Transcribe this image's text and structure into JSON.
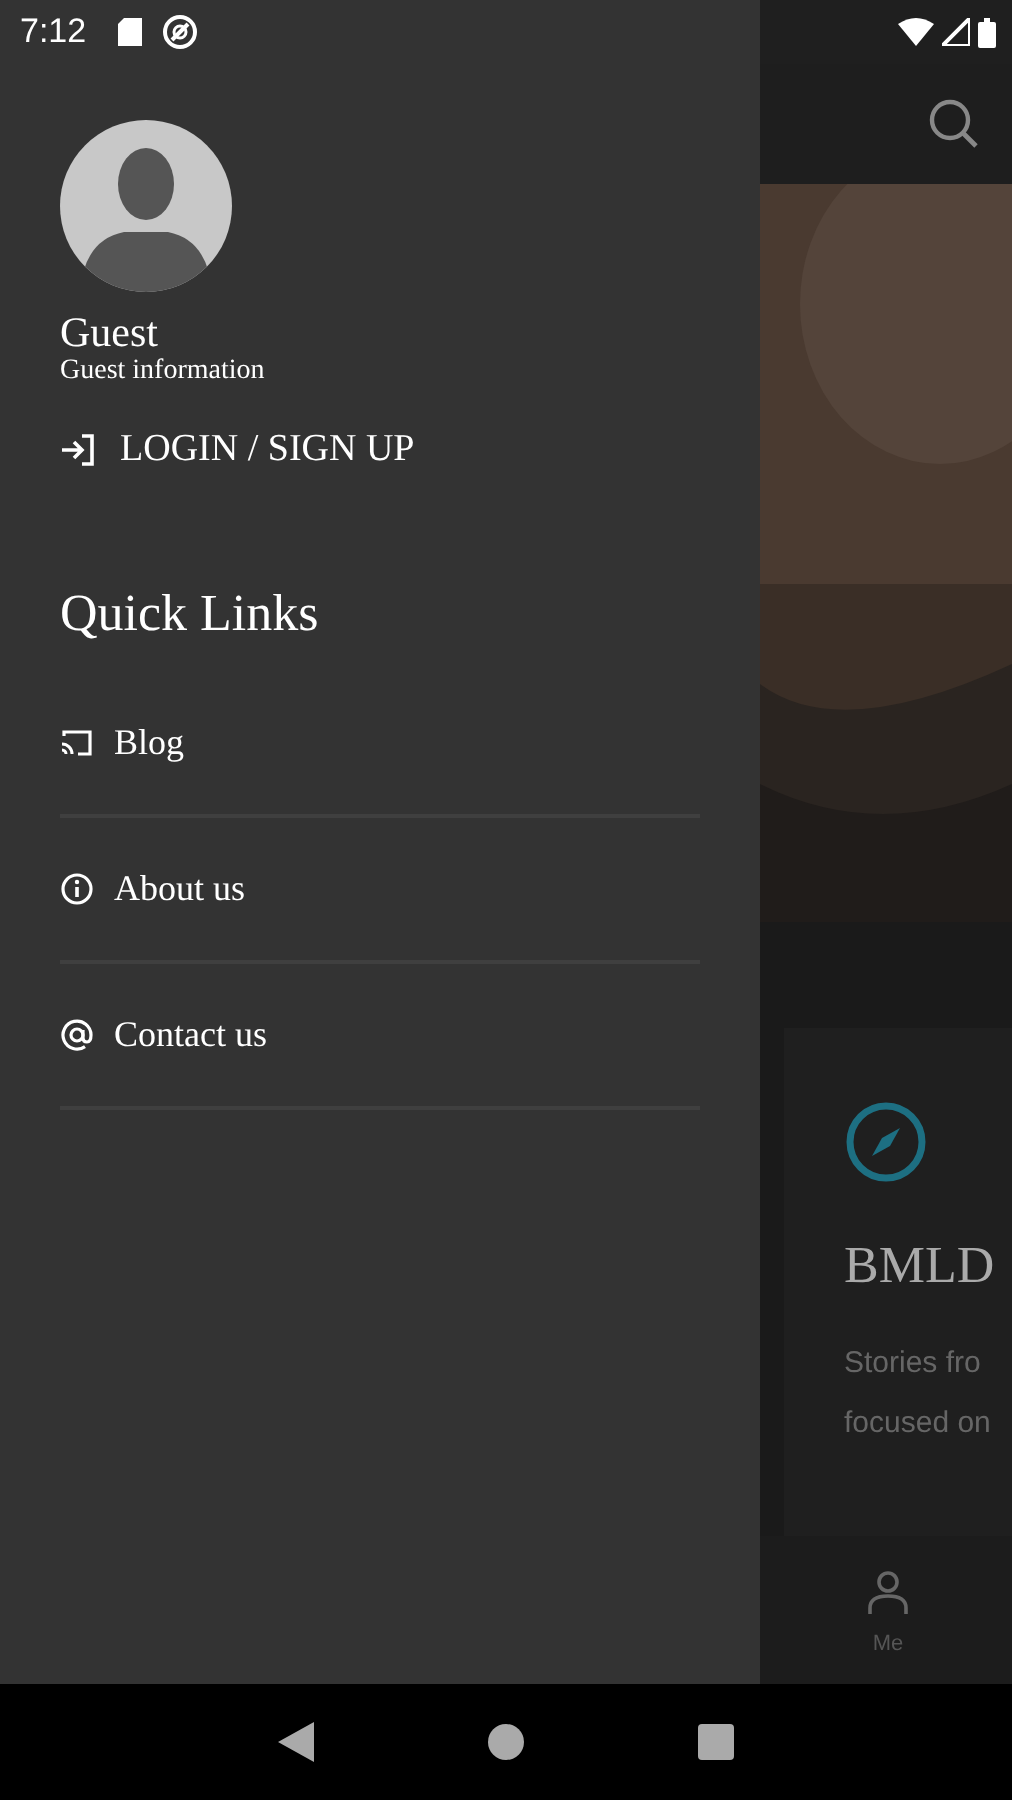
{
  "status_bar": {
    "time": "7:12"
  },
  "drawer": {
    "user": {
      "name": "Guest",
      "subtitle": "Guest information"
    },
    "login": "LOGIN / SIGN UP",
    "section_title": "Quick Links",
    "links": [
      {
        "kind": "blog",
        "label": "Blog"
      },
      {
        "kind": "about",
        "label": "About us"
      },
      {
        "kind": "contact",
        "label": "Contact us"
      }
    ]
  },
  "background": {
    "card": {
      "title": "BMLD",
      "lines": [
        "Stories fro",
        "focused on"
      ]
    },
    "bottom_nav": [
      {
        "label": "Me"
      }
    ]
  }
}
